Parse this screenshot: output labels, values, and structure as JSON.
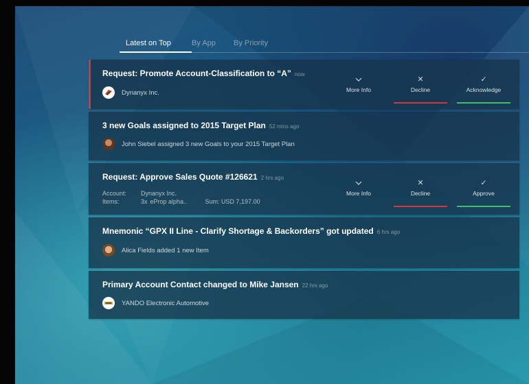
{
  "tabs": [
    {
      "label": "Latest on Top",
      "active": true
    },
    {
      "label": "By App",
      "active": false
    },
    {
      "label": "By Priority",
      "active": false
    }
  ],
  "notifications": [
    {
      "title": "Request: Promote Account-Classification to “A”",
      "time": "now",
      "source": "Dynanyx Inc.",
      "avatar_icon": "company-logo-icon",
      "priority": "high",
      "actions": [
        {
          "icon": "chevron-down-icon",
          "label": "More Info",
          "bar_color": ""
        },
        {
          "icon": "x-icon",
          "label": "Decline",
          "bar_color": "#d2383f"
        },
        {
          "icon": "check-icon",
          "label": "Acknowledge",
          "bar_color": "#3fbf6b"
        }
      ]
    },
    {
      "title": "3 new Goals assigned to 2015 Target Plan",
      "time": "52 mins ago",
      "description": "John Siebel assigned 3 new Goals to your 2015 Target Plan",
      "avatar_icon": "user-avatar-icon"
    },
    {
      "title": "Request: Approve Sales Quote #126621",
      "time": "2 hrs ago",
      "account_label": "Account:",
      "account_value": "Dynanyx Inc.",
      "items_label": "Items:",
      "items_qty": "3x",
      "items_value": "eProp alpha..",
      "sum_label": "Sum:",
      "sum_value": "USD 7,197.00",
      "actions": [
        {
          "icon": "chevron-down-icon",
          "label": "More Info",
          "bar_color": ""
        },
        {
          "icon": "x-icon",
          "label": "Decline",
          "bar_color": "#d2383f"
        },
        {
          "icon": "check-icon",
          "label": "Approve",
          "bar_color": "#3fbf6b"
        }
      ]
    },
    {
      "title": "Mnemonic “GPX II Line - Clarify Shortage & Backorders” got updated",
      "time": "6 hrs ago",
      "description": "Alica Fields added 1 new Item",
      "avatar_icon": "user-avatar-icon"
    },
    {
      "title": "Primary Account Contact changed to Mike Jansen",
      "time": "22 hrs ago",
      "source": "YANDO Electronic Automotive",
      "avatar_icon": "company-logo-icon"
    }
  ]
}
